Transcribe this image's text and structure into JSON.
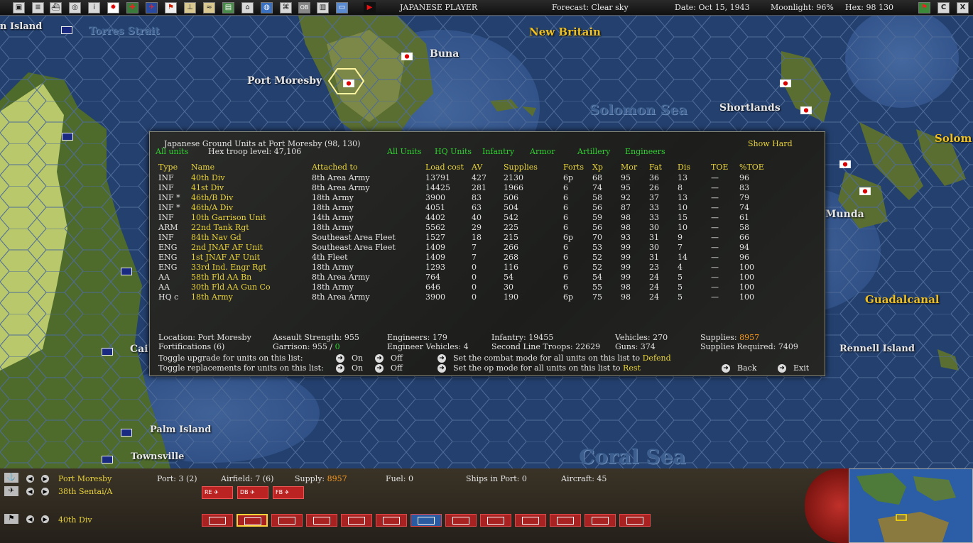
{
  "topbar": {
    "toolbar_icons": [
      "report-icon",
      "list-icon",
      "ships-icon",
      "groups-icon",
      "info-icon",
      "japan-flag-icon",
      "plus-icon",
      "air-icon",
      "flag-icon",
      "airfield-icon",
      "route-icon",
      "map-icon",
      "base-icon",
      "globe-icon",
      "network-icon",
      "ob-icon",
      "film-icon",
      "dialog-icon",
      "play-icon"
    ],
    "ob_label": "OB",
    "player": "JAPANESE PLAYER",
    "forecast": "Forecast: Clear sky",
    "date": "Date: Oct 15, 1943",
    "moonlight": "Moonlight: 96%",
    "hex": "Hex: 98  130",
    "right_icons": [
      "flag-icon",
      "c-icon",
      "close-icon"
    ],
    "c_label": "C",
    "close_label": "X"
  },
  "map_labels": {
    "island": "n Island",
    "torres": "Torres Strait",
    "new_britain": "New Britain",
    "buna": "Buna",
    "port_moresby": "Port Moresby",
    "solomon_sea": "Solomon Sea",
    "shortlands": "Shortlands",
    "solom": "Solom",
    "munda": "Munda",
    "guadalcanal": "Guadalcanal",
    "rennell": "Rennell Island",
    "cai": "Cai",
    "palm": "Palm Island",
    "townsville": "Townsville",
    "coral_sea": "Coral Sea"
  },
  "dialog": {
    "title": "Japanese Ground Units at Port Moresby  (98, 130)",
    "all_units_left": "All units",
    "troop_level": "Hex troop level: 47,106",
    "show_hard": "Show Hard",
    "filters": [
      "All Units",
      "HQ Units",
      "Infantry",
      "Armor",
      "Artillery",
      "Engineers"
    ],
    "columns": [
      "Type",
      "Name",
      "Attached to",
      "Load cost",
      "AV",
      "Supplies",
      "Forts",
      "Xp",
      "Mor",
      "Fat",
      "Dis",
      "TOE",
      "%TOE"
    ],
    "rows": [
      {
        "type": "INF",
        "name": "40th Div",
        "attached": "8th Area Army",
        "load": "13791",
        "av": "427",
        "supplies": "2130",
        "forts": "6p",
        "xp": "68",
        "mor": "95",
        "fat": "36",
        "dis": "13",
        "toe": "—",
        "ptoe": "96"
      },
      {
        "type": "INF",
        "name": "41st Div",
        "attached": "8th Area Army",
        "load": "14425",
        "av": "281",
        "supplies": "1966",
        "forts": "6",
        "xp": "74",
        "mor": "95",
        "fat": "26",
        "dis": "8",
        "toe": "—",
        "ptoe": "83"
      },
      {
        "type": "INF *",
        "name": "46th/B Div",
        "attached": "18th Army",
        "load": "3900",
        "av": "83",
        "supplies": "506",
        "forts": "6",
        "xp": "58",
        "mor": "92",
        "fat": "37",
        "dis": "13",
        "toe": "—",
        "ptoe": "79"
      },
      {
        "type": "INF *",
        "name": "46th/A Div",
        "attached": "18th Army",
        "load": "4051",
        "av": "63",
        "supplies": "504",
        "forts": "6",
        "xp": "56",
        "mor": "87",
        "fat": "33",
        "dis": "10",
        "toe": "—",
        "ptoe": "74"
      },
      {
        "type": "INF",
        "name": "10th Garrison Unit",
        "attached": "14th Army",
        "load": "4402",
        "av": "40",
        "supplies": "542",
        "forts": "6",
        "xp": "59",
        "mor": "98",
        "fat": "33",
        "dis": "15",
        "toe": "—",
        "ptoe": "61"
      },
      {
        "type": "ARM",
        "name": "22nd Tank Rgt",
        "attached": "18th Army",
        "load": "5562",
        "av": "29",
        "supplies": "225",
        "forts": "6",
        "xp": "56",
        "mor": "98",
        "fat": "30",
        "dis": "10",
        "toe": "—",
        "ptoe": "58"
      },
      {
        "type": "INF",
        "name": "84th Nav Gd",
        "attached": "Southeast Area Fleet",
        "load": "1527",
        "av": "18",
        "supplies": "215",
        "forts": "6p",
        "xp": "70",
        "mor": "93",
        "fat": "31",
        "dis": "9",
        "toe": "—",
        "ptoe": "66"
      },
      {
        "type": "ENG",
        "name": "2nd JNAF AF Unit",
        "attached": "Southeast Area Fleet",
        "load": "1409",
        "av": "7",
        "supplies": "266",
        "forts": "6",
        "xp": "53",
        "mor": "99",
        "fat": "30",
        "dis": "7",
        "toe": "—",
        "ptoe": "94"
      },
      {
        "type": "ENG",
        "name": "1st JNAF AF Unit",
        "attached": "4th Fleet",
        "load": "1409",
        "av": "7",
        "supplies": "268",
        "forts": "6",
        "xp": "52",
        "mor": "99",
        "fat": "31",
        "dis": "14",
        "toe": "—",
        "ptoe": "96"
      },
      {
        "type": "ENG",
        "name": "33rd Ind. Engr Rgt",
        "attached": "18th Army",
        "load": "1293",
        "av": "0",
        "supplies": "116",
        "forts": "6",
        "xp": "52",
        "mor": "99",
        "fat": "23",
        "dis": "4",
        "toe": "—",
        "ptoe": "100"
      },
      {
        "type": "AA",
        "name": "58th Fld AA Bn",
        "attached": "8th Area Army",
        "load": "764",
        "av": "0",
        "supplies": "54",
        "forts": "6",
        "xp": "54",
        "mor": "99",
        "fat": "24",
        "dis": "5",
        "toe": "—",
        "ptoe": "100"
      },
      {
        "type": "AA",
        "name": "30th Fld AA Gun Co",
        "attached": "18th Army",
        "load": "646",
        "av": "0",
        "supplies": "30",
        "forts": "6",
        "xp": "55",
        "mor": "98",
        "fat": "24",
        "dis": "5",
        "toe": "—",
        "ptoe": "100"
      },
      {
        "type": "HQ c",
        "name": "18th Army",
        "attached": "8th Area Army",
        "load": "3900",
        "av": "0",
        "supplies": "190",
        "forts": "6p",
        "xp": "75",
        "mor": "98",
        "fat": "24",
        "dis": "5",
        "toe": "—",
        "ptoe": "100"
      }
    ],
    "summary": {
      "location": "Location: Port Moresby",
      "fortifications": "Fortifications (6)",
      "assault": "Assault Strength: 955",
      "garrison_label": "Garrison:  955 /",
      "garrison_value": "0",
      "engineers": "Engineers: 179",
      "eng_vehicles": "Engineer Vehicles: 4",
      "infantry": "Infantry: 19455",
      "second_line": "Second Line Troops: 22629",
      "vehicles": "Vehicles: 270",
      "guns": "Guns: 374",
      "supplies_label": "Supplies:",
      "supplies_value": "8957",
      "supplies_required": "Supplies Required:  7409"
    },
    "toggles": {
      "upgrade_label": "Toggle upgrade for units on this list:",
      "replacements_label": "Toggle replacements for units on this list:",
      "on": "On",
      "off": "Off",
      "combat_label": "Set the combat mode for all units on this list to",
      "combat_value": "Defend",
      "op_label": "Set the op mode for all units on this list to",
      "op_value": "Rest",
      "back": "Back",
      "exit": "Exit"
    }
  },
  "bottom": {
    "base_name": "Port Moresby",
    "port": "Port: 3 (2)",
    "airfield": "Airfield: 7 (6)",
    "supply_label": "Supply:",
    "supply_value": "8957",
    "fuel": "Fuel: 0",
    "ships": "Ships in Port: 0",
    "aircraft": "Aircraft: 45",
    "air_unit": "38th Sentai/A",
    "ground_unit": "40th Div",
    "air_buttons": [
      "RE",
      "DB",
      "FB"
    ],
    "colors": {
      "japan_red": "#b22222",
      "label_yellow": "#e8d23a",
      "filter_green": "#30d030",
      "value_orange": "#ff9a1a"
    }
  }
}
